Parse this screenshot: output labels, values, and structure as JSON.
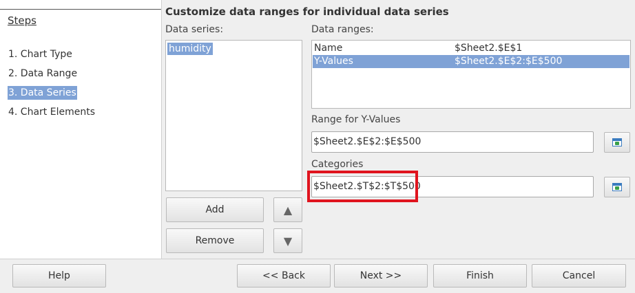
{
  "steps": {
    "title": "Steps",
    "items": [
      "1. Chart Type",
      "2. Data Range",
      "3. Data Series",
      "4. Chart Elements"
    ],
    "active_index": 2
  },
  "heading": "Customize data ranges for individual data series",
  "data_series": {
    "label": "Data series:",
    "items": [
      "humidity"
    ]
  },
  "buttons": {
    "add": "Add",
    "remove": "Remove",
    "up_glyph": "▲",
    "down_glyph": "▼"
  },
  "data_ranges": {
    "label": "Data ranges:",
    "rows": [
      {
        "name": "Name",
        "range": "$Sheet2.$E$1"
      },
      {
        "name": "Y-Values",
        "range": "$Sheet2.$E$2:$E$500"
      }
    ],
    "selected_index": 1
  },
  "range_for": {
    "label": "Range for Y-Values",
    "value": "$Sheet2.$E$2:$E$500"
  },
  "categories": {
    "label": "Categories",
    "value": "$Sheet2.$T$2:$T$500"
  },
  "footer": {
    "help": "Help",
    "back": "<< Back",
    "next": "Next >>",
    "finish": "Finish",
    "cancel": "Cancel"
  },
  "colors": {
    "selection": "#7fa2d6",
    "highlight_box": "#e0141e"
  },
  "icons": {
    "range_select": "select-range-icon"
  }
}
